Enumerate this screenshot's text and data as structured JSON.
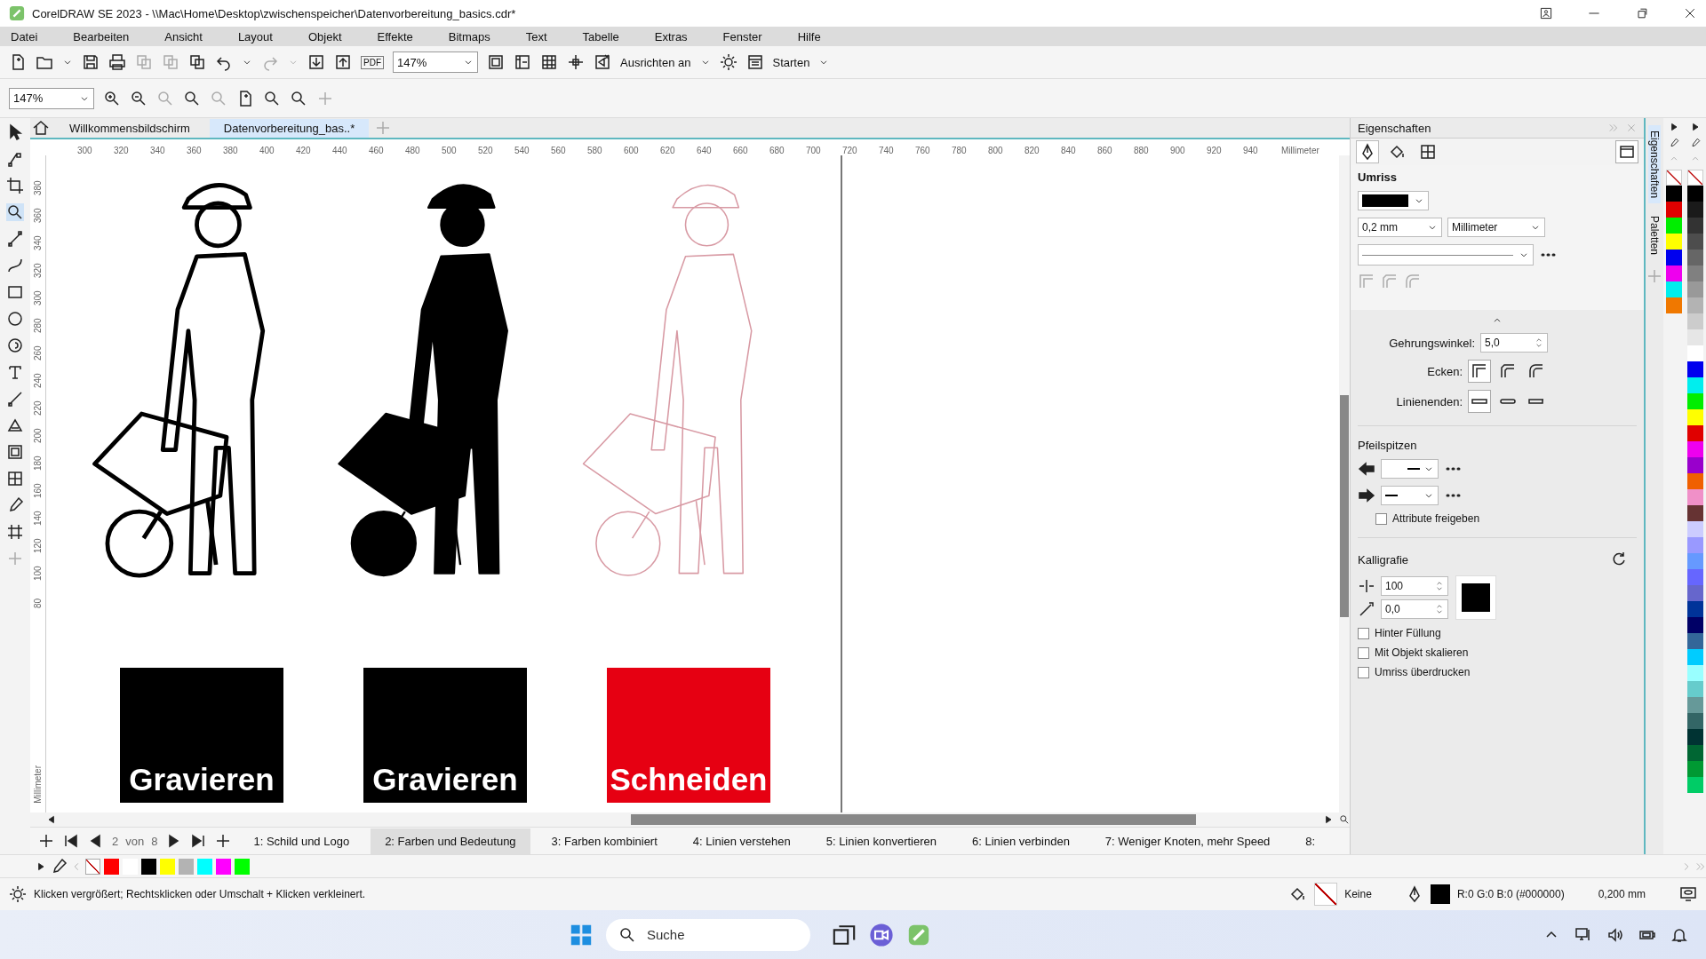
{
  "window": {
    "title": "CorelDRAW SE 2023 - \\\\Mac\\Home\\Desktop\\zwischenspeicher\\Datenvorbereitung_basics.cdr*"
  },
  "menu": [
    "Datei",
    "Bearbeiten",
    "Ansicht",
    "Layout",
    "Objekt",
    "Effekte",
    "Bitmaps",
    "Text",
    "Tabelle",
    "Extras",
    "Fenster",
    "Hilfe"
  ],
  "toolbar": {
    "pdf_label": "PDF",
    "zoom": "147%",
    "snap_label": "Ausrichten an",
    "launch_label": "Starten"
  },
  "zoom_toolbar": {
    "zoom": "147%"
  },
  "document_tabs": [
    {
      "label": "Willkommensbildschirm",
      "selected": false
    },
    {
      "label": "Datenvorbereitung_bas..*",
      "selected": true
    }
  ],
  "ruler": {
    "x_ticks": [
      "300",
      "320",
      "340",
      "360",
      "380",
      "400",
      "420",
      "440",
      "460",
      "480",
      "500",
      "520",
      "540",
      "560",
      "580",
      "600",
      "620",
      "640",
      "660",
      "680",
      "700",
      "720",
      "740",
      "760",
      "780",
      "800",
      "820",
      "840",
      "860",
      "880",
      "900",
      "920",
      "940"
    ],
    "x_unit": "Millimeter",
    "y_ticks": [
      "380",
      "360",
      "340",
      "320",
      "300",
      "280",
      "260",
      "240",
      "220",
      "200",
      "180",
      "160",
      "140",
      "120",
      "100",
      "80"
    ],
    "y_unit": "Millimeter"
  },
  "canvas": {
    "figures": [
      {
        "kind": "outline",
        "color": "#000000"
      },
      {
        "kind": "filled",
        "color": "#000000"
      },
      {
        "kind": "outline",
        "color": "#d89aa4"
      }
    ],
    "labels": [
      {
        "text": "Gravieren",
        "color": "#000000"
      },
      {
        "text": "Gravieren",
        "color": "#000000"
      },
      {
        "text": "Schneiden",
        "color": "#e60012"
      }
    ]
  },
  "page_nav": {
    "current": "2",
    "of": "von",
    "total": "8"
  },
  "page_tabs": [
    {
      "label": "1: Schild und Logo",
      "selected": false
    },
    {
      "label": "2: Farben und Bedeutung",
      "selected": true
    },
    {
      "label": "3: Farben kombiniert",
      "selected": false
    },
    {
      "label": "4: Linien verstehen",
      "selected": false
    },
    {
      "label": "5: Linien konvertieren",
      "selected": false
    },
    {
      "label": "6: Linien verbinden",
      "selected": false
    },
    {
      "label": "7: Weniger Knoten, mehr Speed",
      "selected": false
    },
    {
      "label": "8:",
      "selected": false
    }
  ],
  "properties": {
    "title": "Eigenschaften",
    "tabs": [
      {
        "selected": true
      },
      {
        "selected": false
      },
      {
        "selected": false
      }
    ],
    "outline_heading": "Umriss",
    "width": "0,2 mm",
    "unit": "Millimeter",
    "miter_label": "Gehrungswinkel:",
    "miter": "5,0",
    "corners_label": "Ecken:",
    "corners": [
      {
        "selected": true
      },
      {
        "selected": false
      },
      {
        "selected": false
      }
    ],
    "caps_label": "Linienenden:",
    "caps": [
      {
        "selected": true
      },
      {
        "selected": false
      },
      {
        "selected": false
      }
    ],
    "arrows_heading": "Pfeilspitzen",
    "share": {
      "label": "Attribute freigeben",
      "checked": false
    },
    "calligraphy_heading": "Kalligrafie",
    "stretch": "100",
    "angle": "0,0",
    "options": [
      {
        "label": "Hinter Füllung",
        "checked": false
      },
      {
        "label": "Mit Objekt skalieren",
        "checked": false
      },
      {
        "label": "Umriss überdrucken",
        "checked": false
      }
    ]
  },
  "side_tabs": [
    {
      "label": "Eigenschaften",
      "selected": true
    },
    {
      "label": "Paletten",
      "selected": false
    }
  ],
  "palettes": [
    {
      "swatches": [
        {
          "kind": "none"
        },
        {
          "kind": "color",
          "color": "#000000"
        },
        {
          "kind": "color",
          "color": "#e00000"
        },
        {
          "kind": "color",
          "color": "#00ee00"
        },
        {
          "kind": "color",
          "color": "#ffff00"
        },
        {
          "kind": "color",
          "color": "#0000ee"
        },
        {
          "kind": "color",
          "color": "#ee00ee"
        },
        {
          "kind": "color",
          "color": "#00eeee"
        },
        {
          "kind": "color",
          "color": "#f07800"
        }
      ]
    },
    {
      "swatches": [
        {
          "kind": "none"
        },
        {
          "kind": "color",
          "color": "#000000"
        },
        {
          "kind": "color",
          "color": "#1a1a1a"
        },
        {
          "kind": "color",
          "color": "#333333"
        },
        {
          "kind": "color",
          "color": "#4d4d4d"
        },
        {
          "kind": "color",
          "color": "#666666"
        },
        {
          "kind": "color",
          "color": "#808080"
        },
        {
          "kind": "color",
          "color": "#999999"
        },
        {
          "kind": "color",
          "color": "#b3b3b3"
        },
        {
          "kind": "color",
          "color": "#cccccc"
        },
        {
          "kind": "color",
          "color": "#e6e6e6"
        },
        {
          "kind": "color",
          "color": "#ffffff"
        },
        {
          "kind": "color",
          "color": "#0000ee"
        },
        {
          "kind": "color",
          "color": "#00eeee"
        },
        {
          "kind": "color",
          "color": "#00ee00"
        },
        {
          "kind": "color",
          "color": "#ffff00"
        },
        {
          "kind": "color",
          "color": "#e00000"
        },
        {
          "kind": "color",
          "color": "#ee00ee"
        },
        {
          "kind": "color",
          "color": "#9900cc"
        },
        {
          "kind": "color",
          "color": "#f06000"
        },
        {
          "kind": "color",
          "color": "#f090c8"
        },
        {
          "kind": "color",
          "color": "#663333"
        },
        {
          "kind": "color",
          "color": "#ccccff"
        },
        {
          "kind": "color",
          "color": "#9999ff"
        },
        {
          "kind": "color",
          "color": "#6699ff"
        },
        {
          "kind": "color",
          "color": "#6666ff"
        },
        {
          "kind": "color",
          "color": "#6666cc"
        },
        {
          "kind": "color",
          "color": "#003399"
        },
        {
          "kind": "color",
          "color": "#000066"
        },
        {
          "kind": "color",
          "color": "#336699"
        },
        {
          "kind": "color",
          "color": "#00ccff"
        },
        {
          "kind": "color",
          "color": "#99ffff"
        },
        {
          "kind": "color",
          "color": "#66cccc"
        },
        {
          "kind": "color",
          "color": "#669999"
        },
        {
          "kind": "color",
          "color": "#336666"
        },
        {
          "kind": "color",
          "color": "#003333"
        },
        {
          "kind": "color",
          "color": "#006633"
        },
        {
          "kind": "color",
          "color": "#009933"
        },
        {
          "kind": "color",
          "color": "#00cc66"
        }
      ]
    }
  ],
  "bottom_palette": [
    {
      "kind": "none"
    },
    {
      "kind": "color",
      "color": "#ff0000"
    },
    {
      "kind": "color",
      "color": "#ffffff"
    },
    {
      "kind": "color",
      "color": "#000000"
    },
    {
      "kind": "color",
      "color": "#ffff00"
    },
    {
      "kind": "color",
      "color": "#b3b3b3"
    },
    {
      "kind": "color",
      "color": "#00ffff"
    },
    {
      "kind": "color",
      "color": "#ff00ff"
    },
    {
      "kind": "color",
      "color": "#00ff00"
    }
  ],
  "status_bar": {
    "hint": "Klicken vergrößert; Rechtsklicken oder Umschalt + Klicken verkleinert.",
    "fill": "Keine",
    "outline": "R:0 G:0 B:0 (#000000)",
    "outline_width": "0,200 mm"
  },
  "taskbar": {
    "search_placeholder": "Suche"
  }
}
